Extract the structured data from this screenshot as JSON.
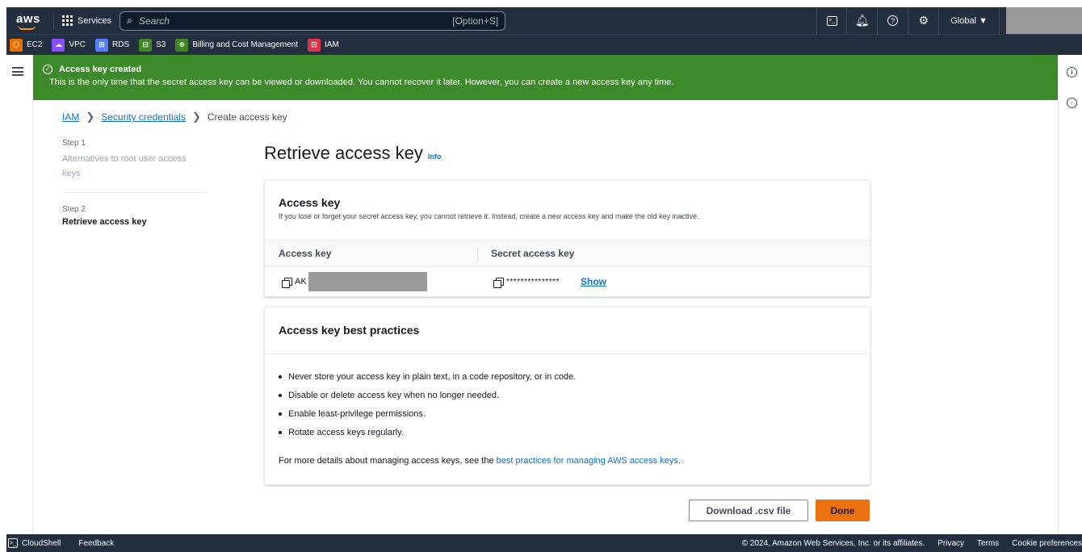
{
  "top_nav": {
    "logo_text": "aws",
    "services_label": "Services",
    "search_placeholder": "Search",
    "search_shortcut": "[Option+S]",
    "region_label": "Global ▼",
    "icons": [
      "cloudshell-icon",
      "bell-icon",
      "help-icon",
      "gear-icon"
    ]
  },
  "favorites": [
    {
      "label": "EC2",
      "color": "#ed7100"
    },
    {
      "label": "VPC",
      "color": "#8c4fff"
    },
    {
      "label": "RDS",
      "color": "#527fff"
    },
    {
      "label": "S3",
      "color": "#3f8624"
    },
    {
      "label": "Billing and Cost Management",
      "color": "#3f8624"
    },
    {
      "label": "IAM",
      "color": "#dd344c"
    }
  ],
  "flash": {
    "title": "Access key created",
    "message": "This is the only time that the secret access key can be viewed or downloaded. You cannot recover it later. However, you can create a new access key any time.",
    "color": "#3d8a2a"
  },
  "breadcrumb": {
    "items": [
      "IAM",
      "Security credentials"
    ],
    "current": "Create access key"
  },
  "steps": [
    {
      "label": "Step 1",
      "title": "Alternatives to root user access keys"
    },
    {
      "label": "Step 2",
      "title": "Retrieve access key"
    }
  ],
  "page": {
    "title": "Retrieve access key",
    "info_link": "Info"
  },
  "access_key_panel": {
    "heading": "Access key",
    "description": "If you lose or forget your secret access key, you cannot retrieve it. Instead, create a new access key and make the old key inactive.",
    "columns": [
      "Access key",
      "Secret access key"
    ],
    "access_key_prefix": "AK",
    "secret_masked": "***************",
    "show_label": "Show"
  },
  "best_practices": {
    "heading": "Access key best practices",
    "items": [
      "Never store your access key in plain text, in a code repository, or in code.",
      "Disable or delete access key when no longer needed.",
      "Enable least-privilege permissions.",
      "Rotate access keys regularly."
    ],
    "more_prefix": "For more details about managing access keys, see the ",
    "more_link": "best practices for managing AWS access keys",
    "more_suffix": "."
  },
  "actions": {
    "download": "Download .csv file",
    "done": "Done",
    "done_color": "#ec7211"
  },
  "footer": {
    "cloudshell": "CloudShell",
    "feedback": "Feedback",
    "copyright": "© 2024, Amazon Web Services, Inc. or its affiliates.",
    "links": [
      "Privacy",
      "Terms",
      "Cookie preferences"
    ]
  }
}
